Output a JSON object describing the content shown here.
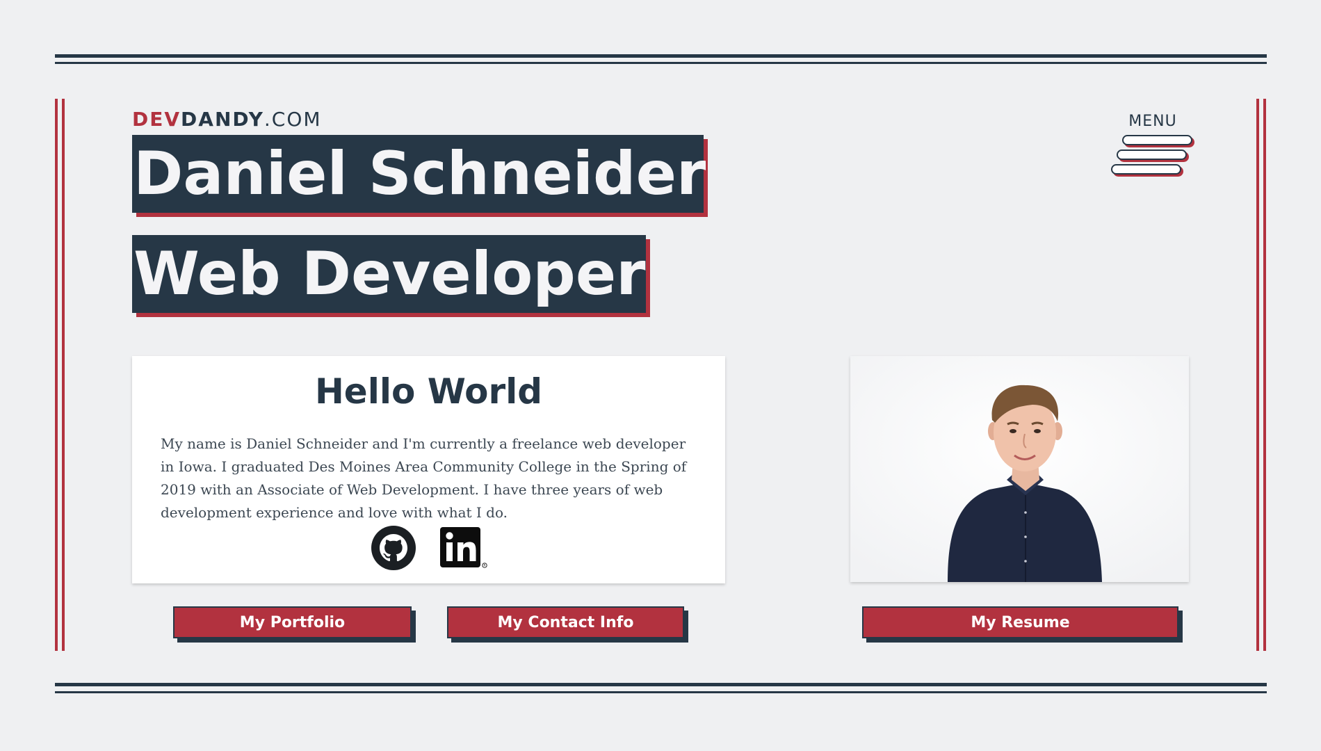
{
  "logo": {
    "dev": "DEV",
    "dandy": "DANDY",
    "dom": ".COM"
  },
  "menu": {
    "label": "MENU"
  },
  "hero": {
    "line1": "Daniel Schneider",
    "line2": "Web Developer"
  },
  "intro": {
    "title": "Hello World",
    "body": "My name is Daniel Schneider and I'm currently a freelance web developer in Iowa. I graduated Des Moines Area Community College in the Spring of 2019 with an Associate of Web Development. I have three years of web development experience and love with what I do."
  },
  "social": {
    "github_icon": "github-icon",
    "linkedin_icon": "linkedin-icon"
  },
  "buttons": {
    "portfolio": "My Portfolio",
    "contact": "My Contact Info",
    "resume": "My Resume"
  },
  "colors": {
    "navy": "#263746",
    "red": "#b2323f",
    "background": "#eff0f2",
    "card": "#ffffff"
  }
}
